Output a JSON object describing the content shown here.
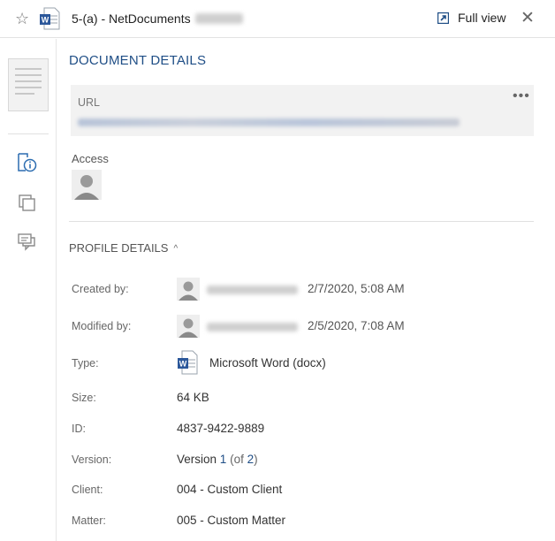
{
  "header": {
    "title": "5-(a) - NetDocuments",
    "full_view_label": "Full view",
    "star_glyph": "☆",
    "close_glyph": "✕"
  },
  "panel": {
    "section_title": "DOCUMENT DETAILS",
    "url": {
      "label": "URL",
      "more_glyph": "•••"
    },
    "access": {
      "label": "Access"
    },
    "profile": {
      "title": "PROFILE DETAILS",
      "chevron_glyph": "^",
      "created": {
        "label": "Created by:",
        "date": "2/7/2020, 5:08 AM"
      },
      "modified": {
        "label": "Modified by:",
        "date": "2/5/2020, 7:08 AM"
      },
      "type": {
        "label": "Type:",
        "value": "Microsoft Word",
        "ext": "(docx)"
      },
      "size": {
        "label": "Size:",
        "value": "64 KB"
      },
      "id": {
        "label": "ID:",
        "value": "4837-9422-9889"
      },
      "version": {
        "label": "Version:",
        "value": "Version",
        "num": "1",
        "of_open": "(of",
        "total": "2",
        "of_close": ")"
      },
      "client": {
        "label": "Client:",
        "value": "004 - Custom Client"
      },
      "matter": {
        "label": "Matter:",
        "value": "005 - Custom Matter"
      }
    }
  },
  "icons": {
    "star": "star-icon",
    "document_type": "word-document-icon",
    "full_view": "expand-icon",
    "close": "close-icon",
    "rail": [
      "document-info-icon",
      "versions-icon",
      "comments-icon"
    ]
  },
  "colors": {
    "accent": "#1f4e86",
    "word_blue": "#2b579a",
    "url_box_bg": "#f2f2f2",
    "divider": "#e0e0e0"
  }
}
